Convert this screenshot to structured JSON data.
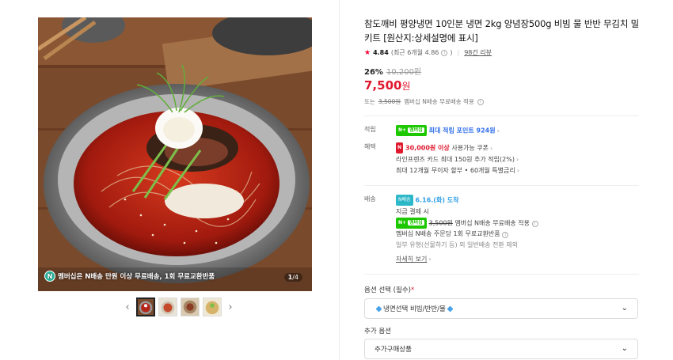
{
  "gallery": {
    "banner_text": "멤버십은 N배송 만원 이상 무료배송, 1회 무료교환반품",
    "page_current": "1",
    "page_total": "/4",
    "prev_icon": "chevron-left-icon",
    "next_icon": "chevron-right-icon",
    "thumb_count": 4
  },
  "product": {
    "title": "참도깨비 평양냉면 10인분 냉면 2kg 양념장500g 비빔 물 반반 무김치 밀키트 [원산지:상세설명에 표시]",
    "rating_score": "4.84",
    "rating_recent": "(최근 6개월 4.86",
    "reviews": "98건 리뷰",
    "discount_rate": "26%",
    "original_price": "10,200원",
    "sale_price": "7,500",
    "sale_unit": "원",
    "ship_prefix": "또는",
    "ship_original": "3,500원",
    "ship_text": "멤버십 N배송 무료배송 적용"
  },
  "points": {
    "label": "적립",
    "badge_n": "N+",
    "badge_mp": "멤버십",
    "text": "최대 적립 포인트 924원"
  },
  "benefits": {
    "label": "혜택",
    "coupon_badge": "N",
    "coupon_amount": "30,000원 이상",
    "coupon_text": "사용가능 쿠폰",
    "card_text": "라인프렌즈 카드 최대 150원 추가 적립(2%)",
    "installment_text": "최대 12개월 무이자 할부 • 60개월 특별금리"
  },
  "delivery": {
    "label": "배송",
    "badge": "N배송",
    "date": "6.16.(화) 도착",
    "condition": "지금 결제 시",
    "ship_original": "3,500원",
    "ship_text": "멤버십 N배송 무료배송 적용",
    "return_text": "멤버십 N배송 주문당 1회 무료교환반품",
    "exception_text": "일부 유형(선물하기 등) 외 일반배송 전환 제외",
    "more_link": "자세히 보기"
  },
  "options": {
    "required_label": "옵션 선택 (필수)",
    "required_mark": "*",
    "required_value": "냉면선택 비빔/반반/물",
    "additional_label": "추가 옵션",
    "additional_value": "추가구매상품"
  },
  "colors": {
    "price_red": "#e0182d",
    "point_blue": "#2f6eea",
    "npay_green": "#1ec800",
    "membership_teal": "#2cc2a6"
  }
}
